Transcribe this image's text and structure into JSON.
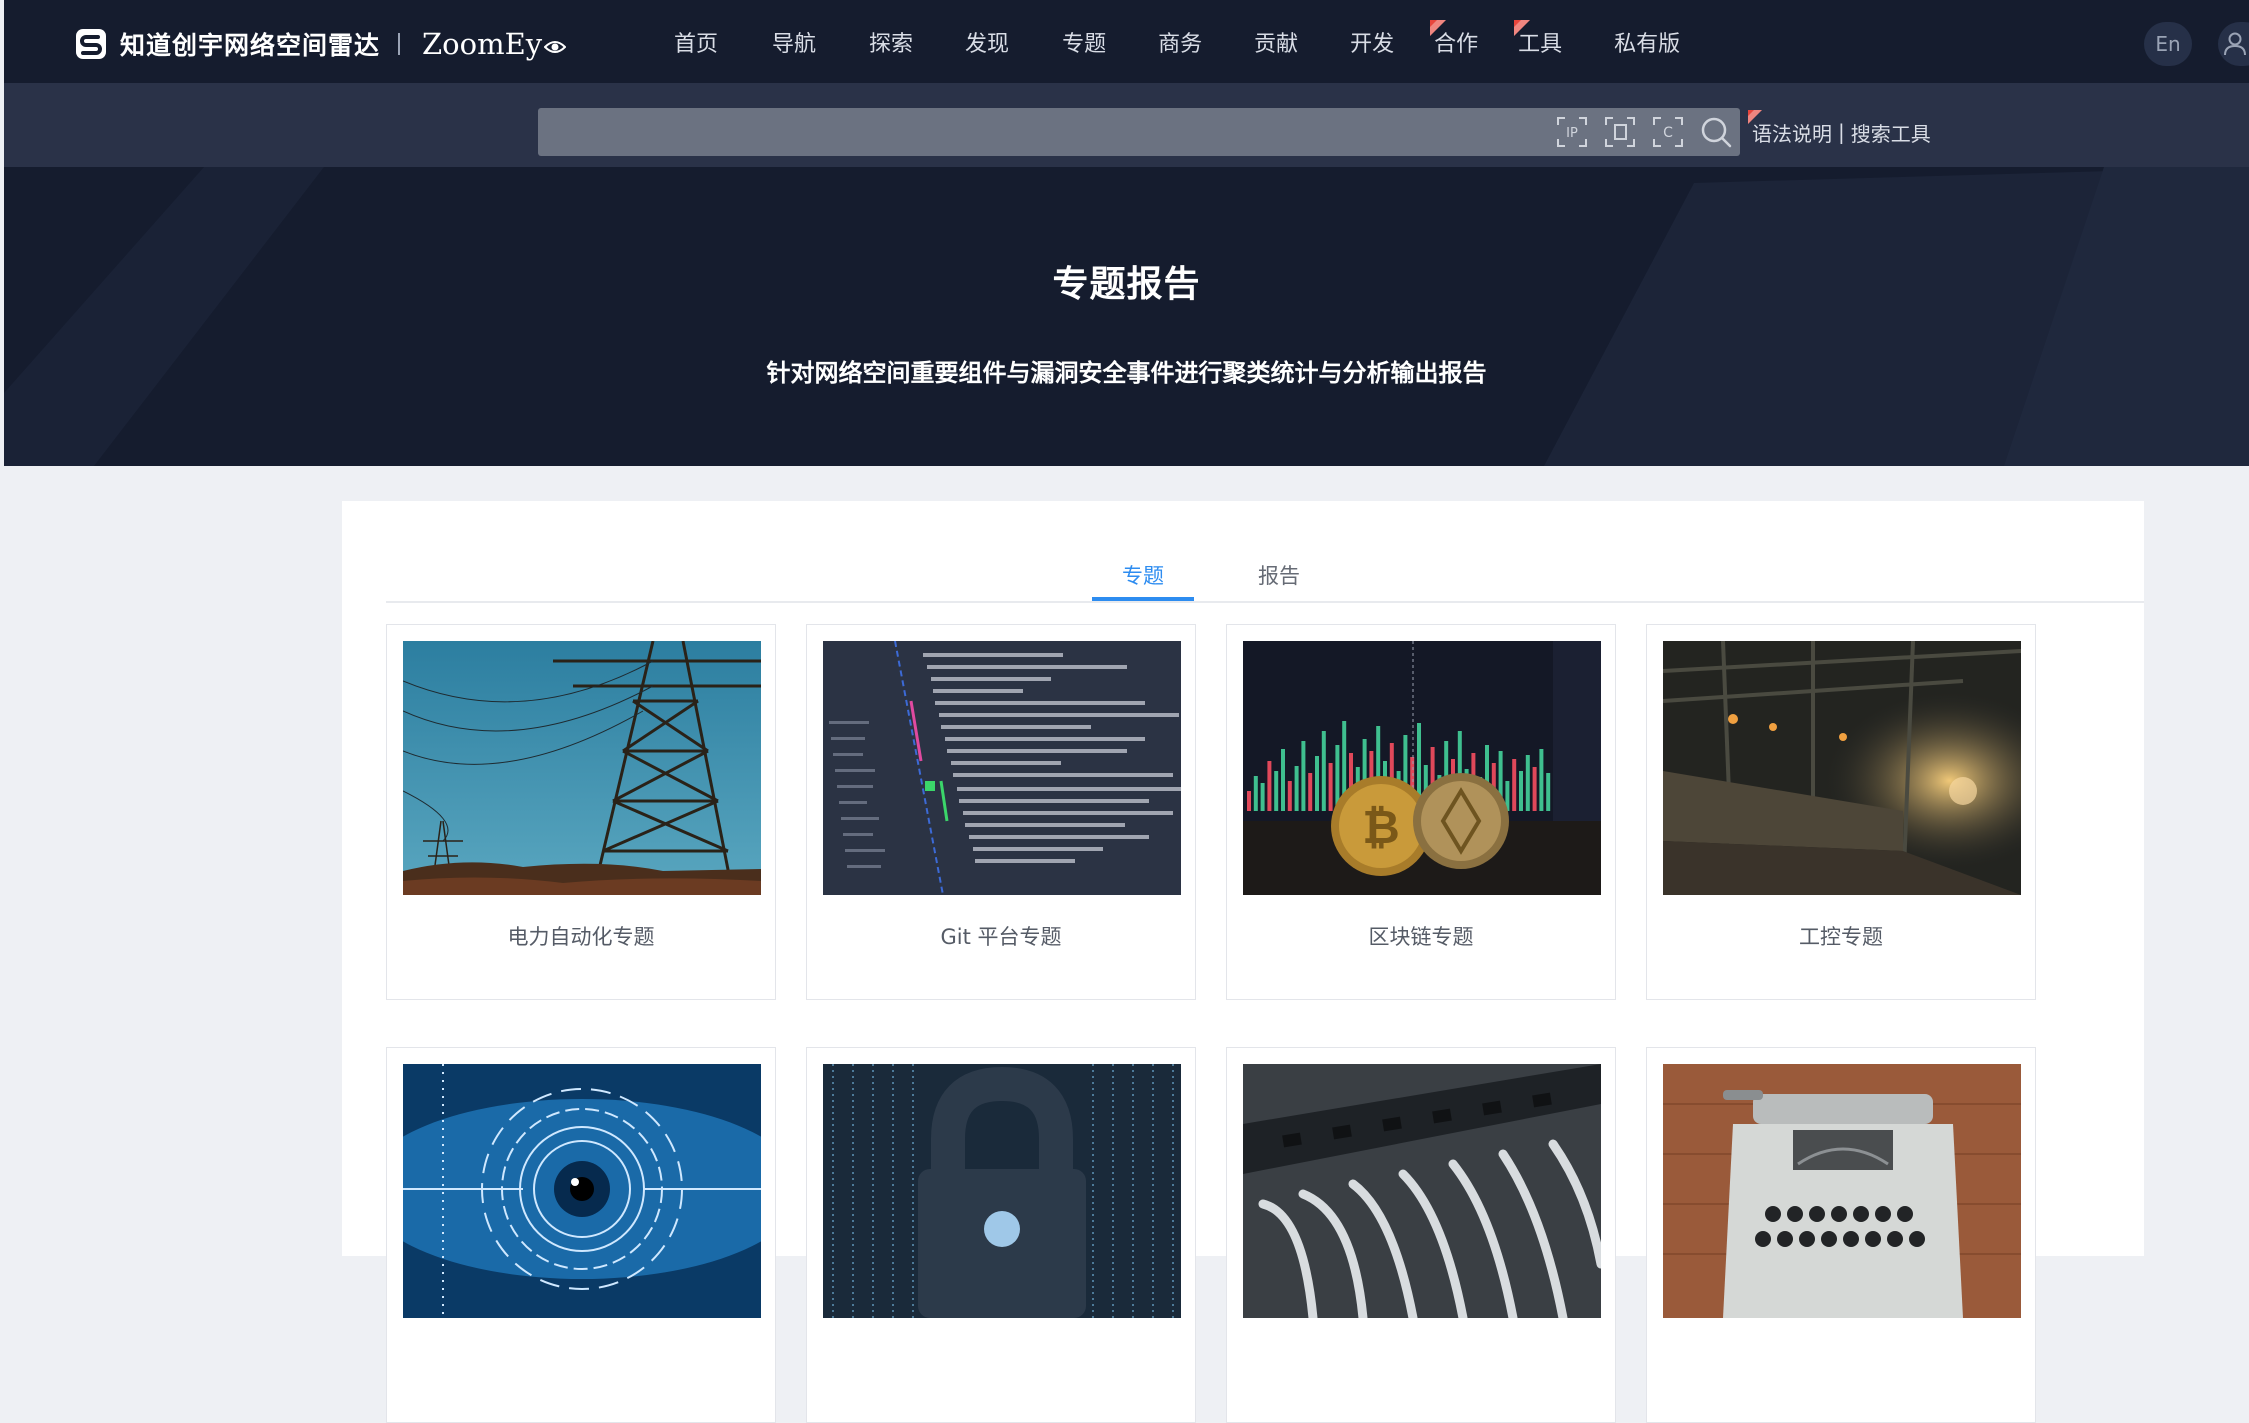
{
  "header": {
    "logo_cn": "知道创宇网络空间雷达",
    "logo_en": "ZoomEy",
    "nav": [
      {
        "label": "首页",
        "badge": false
      },
      {
        "label": "导航",
        "badge": false
      },
      {
        "label": "探索",
        "badge": false
      },
      {
        "label": "发现",
        "badge": false
      },
      {
        "label": "专题",
        "badge": false
      },
      {
        "label": "商务",
        "badge": false
      },
      {
        "label": "贡献",
        "badge": false
      },
      {
        "label": "开发",
        "badge": false
      },
      {
        "label": "合作",
        "badge": true
      },
      {
        "label": "工具",
        "badge": true
      },
      {
        "label": "私有版",
        "badge": false
      }
    ],
    "lang_label": "En"
  },
  "search": {
    "value": "",
    "tools": [
      "ip-search-icon",
      "domain-search-icon",
      "cert-search-icon",
      "search-icon"
    ],
    "syntax_label": "语法说明",
    "separator": "|",
    "tools_label": "搜索工具"
  },
  "hero": {
    "title": "专题报告",
    "subtitle": "针对网络空间重要组件与漏洞安全事件进行聚类统计与分析输出报告"
  },
  "tabs": [
    {
      "label": "专题",
      "active": true
    },
    {
      "label": "报告",
      "active": false
    }
  ],
  "topics": [
    {
      "label": "电力自动化专题",
      "image": "power-tower"
    },
    {
      "label": "Git 平台专题",
      "image": "code-screen"
    },
    {
      "label": "区块链专题",
      "image": "bitcoin-chart"
    },
    {
      "label": "工控专题",
      "image": "industrial-plant"
    },
    {
      "label": "",
      "image": "eye-scan"
    },
    {
      "label": "",
      "image": "padlock-binary"
    },
    {
      "label": "",
      "image": "network-switch"
    },
    {
      "label": "",
      "image": "typewriter"
    }
  ],
  "colors": {
    "nav_bg": "#151c2e",
    "search_bar_bg": "#2a3248",
    "page_bg": "#eef0f4",
    "accent": "#2d8cf0",
    "badge_red": "#e8453c"
  }
}
